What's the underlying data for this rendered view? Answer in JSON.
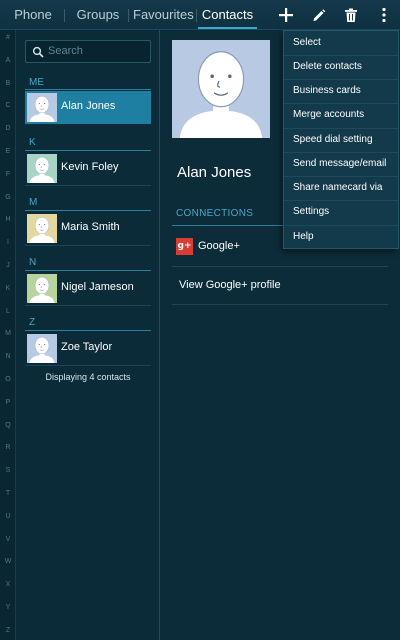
{
  "tabs": [
    {
      "label": "Phone",
      "active": false
    },
    {
      "label": "Groups",
      "active": false
    },
    {
      "label": "Favourites",
      "active": false
    },
    {
      "label": "Contacts",
      "active": true
    }
  ],
  "toolbar_icons": [
    "add-icon",
    "edit-pencil-icon",
    "trash-icon",
    "overflow-menu-icon"
  ],
  "index_letters": [
    "#",
    "A",
    "B",
    "C",
    "D",
    "E",
    "F",
    "G",
    "H",
    "I",
    "J",
    "K",
    "L",
    "M",
    "N",
    "O",
    "P",
    "Q",
    "R",
    "S",
    "T",
    "U",
    "V",
    "W",
    "X",
    "Y",
    "Z"
  ],
  "search": {
    "placeholder": "Search"
  },
  "contacts": {
    "sections": [
      {
        "letter": "ME",
        "name": "Alan Jones",
        "selected": true,
        "avatar_color": "#b8c9e4"
      },
      {
        "letter": "K",
        "name": "Kevin Foley",
        "selected": false,
        "avatar_color": "#a8d4c6"
      },
      {
        "letter": "M",
        "name": "Maria Smith",
        "selected": false,
        "avatar_color": "#e3d7a0"
      },
      {
        "letter": "N",
        "name": "Nigel Jameson",
        "selected": false,
        "avatar_color": "#b9d39c"
      },
      {
        "letter": "Z",
        "name": "Zoe Taylor",
        "selected": false,
        "avatar_color": "#b8c9e4"
      }
    ],
    "count_text": "Displaying 4 contacts"
  },
  "detail": {
    "name": "Alan Jones",
    "connections_label": "CONNECTIONS",
    "gplus_label": "Google+",
    "gplus_icon_text": "g+",
    "gplus_profile_label": "View Google+ profile",
    "avatar_color": "#b8c9e4"
  },
  "menu": {
    "items": [
      "Select",
      "Delete contacts",
      "Business cards",
      "Merge accounts",
      "Speed dial setting",
      "Send message/email",
      "Share namecard via",
      "Settings",
      "Help"
    ]
  },
  "colors": {
    "accent": "#3aa7cf",
    "selected_row": "#1e7fa3",
    "background": "#0d2c3a"
  }
}
